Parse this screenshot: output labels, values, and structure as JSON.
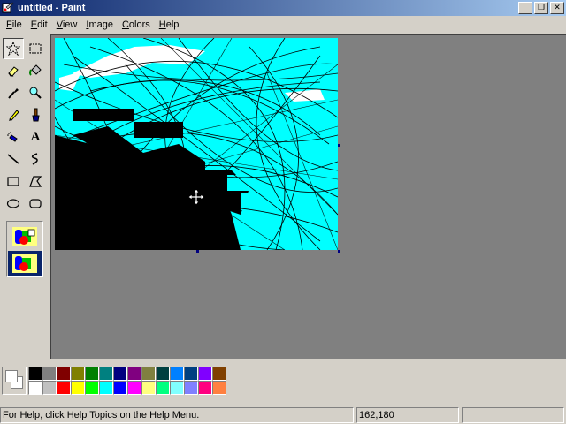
{
  "window": {
    "title": "untitled - Paint",
    "minimize_glyph": "_",
    "restore_glyph": "❐",
    "close_glyph": "✕"
  },
  "menu": {
    "items": [
      {
        "label": "File",
        "mnemonic": "F",
        "rest": "ile"
      },
      {
        "label": "Edit",
        "mnemonic": "E",
        "rest": "dit"
      },
      {
        "label": "View",
        "mnemonic": "V",
        "rest": "iew"
      },
      {
        "label": "Image",
        "mnemonic": "I",
        "rest": "mage"
      },
      {
        "label": "Colors",
        "mnemonic": "C",
        "rest": "olors"
      },
      {
        "label": "Help",
        "mnemonic": "H",
        "rest": "elp"
      }
    ]
  },
  "toolbox": {
    "tools": [
      {
        "name": "free-form-select",
        "icon": "star-select-icon"
      },
      {
        "name": "select",
        "icon": "rect-select-icon"
      },
      {
        "name": "eraser",
        "icon": "eraser-icon"
      },
      {
        "name": "fill",
        "icon": "bucket-icon"
      },
      {
        "name": "pick-color",
        "icon": "eyedropper-icon"
      },
      {
        "name": "magnifier",
        "icon": "magnifier-icon"
      },
      {
        "name": "pencil",
        "icon": "pencil-icon"
      },
      {
        "name": "brush",
        "icon": "brush-icon"
      },
      {
        "name": "airbrush",
        "icon": "airbrush-icon"
      },
      {
        "name": "text",
        "icon": "text-icon",
        "glyph": "A"
      },
      {
        "name": "line",
        "icon": "line-icon"
      },
      {
        "name": "curve",
        "icon": "curve-icon"
      },
      {
        "name": "rectangle",
        "icon": "rectangle-icon"
      },
      {
        "name": "polygon",
        "icon": "polygon-icon"
      },
      {
        "name": "ellipse",
        "icon": "ellipse-icon"
      },
      {
        "name": "rounded-rectangle",
        "icon": "rounded-rect-icon"
      }
    ],
    "options": [
      "opaque-selection",
      "transparent-selection"
    ],
    "selected_option": "transparent-selection"
  },
  "palette": {
    "foreground": "#ffffff",
    "background": "#ffffff",
    "row1": [
      "#000000",
      "#808080",
      "#800000",
      "#808000",
      "#008000",
      "#008080",
      "#000080",
      "#800080",
      "#808040",
      "#004040",
      "#0080ff",
      "#004080",
      "#8000ff",
      "#804000"
    ],
    "row2": [
      "#ffffff",
      "#c0c0c0",
      "#ff0000",
      "#ffff00",
      "#00ff00",
      "#00ffff",
      "#0000ff",
      "#ff00ff",
      "#ffff80",
      "#00ff80",
      "#80ffff",
      "#8080ff",
      "#ff0080",
      "#ff8040"
    ]
  },
  "canvas": {
    "background": "#00ffff",
    "cursor_icon": "move-cursor-icon"
  },
  "status": {
    "help_text": "For Help, click Help Topics on the Help Menu.",
    "coordinates": "162,180",
    "size": ""
  }
}
